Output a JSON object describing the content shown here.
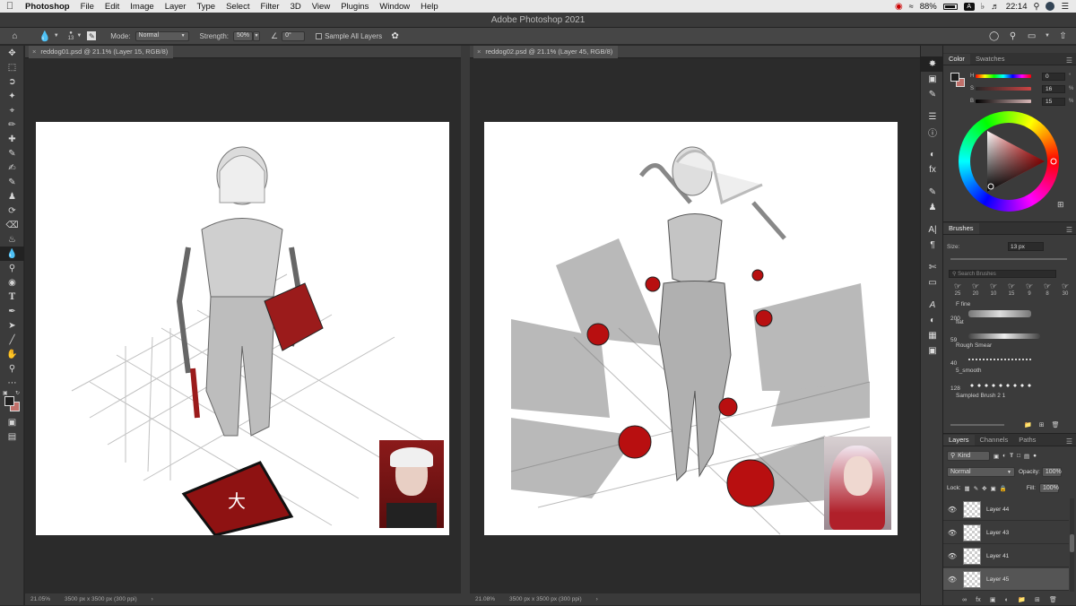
{
  "menubar": {
    "items": [
      "Photoshop",
      "File",
      "Edit",
      "Image",
      "Layer",
      "Type",
      "Select",
      "Filter",
      "3D",
      "View",
      "Plugins",
      "Window",
      "Help"
    ],
    "battery": "88%",
    "input_source": "A",
    "time": "22:14"
  },
  "window_title": "Adobe Photoshop 2021",
  "options": {
    "brush_size": "13",
    "mode_label": "Mode:",
    "mode_value": "Normal",
    "strength_label": "Strength:",
    "strength_value": "50%",
    "angle_value": "0°",
    "sample_all_layers": "Sample All Layers"
  },
  "docs": [
    {
      "tab": "reddog01.psd @ 21.1% (Layer 15, RGB/8)",
      "zoom": "21.05%",
      "info": "3500 px x 3500 px (300 ppi)"
    },
    {
      "tab": "reddog02.psd @ 21.1% (Layer 45, RGB/8)",
      "zoom": "21.08%",
      "info": "3500 px x 3500 px (300 ppi)"
    }
  ],
  "color_panel": {
    "tabs": [
      "Color",
      "Swatches"
    ],
    "h_label": "H",
    "s_label": "S",
    "b_label": "B",
    "h_value": "0",
    "s_value": "16",
    "b_value": "15",
    "h_unit": "°",
    "s_unit": "%",
    "b_unit": "%",
    "foreground_color": "#1e1e1e",
    "background_color": "#c0706a"
  },
  "brushes_panel": {
    "title": "Brushes",
    "size_label": "Size:",
    "size_value": "13 px",
    "search_placeholder": "Search Brushes",
    "tip_sizes": [
      "25",
      "20",
      "10",
      "15",
      "9",
      "8",
      "30"
    ],
    "items": [
      {
        "count": "",
        "name": "F fine"
      },
      {
        "count": "200",
        "name": "flat"
      },
      {
        "count": "59",
        "name": "Rough Smear"
      },
      {
        "count": "40",
        "name": "5_smooth"
      },
      {
        "count": "128",
        "name": "Sampled Brush 2 1"
      }
    ]
  },
  "layers_panel": {
    "tabs": [
      "Layers",
      "Channels",
      "Paths"
    ],
    "kind_label": "Kind",
    "blend_mode": "Normal",
    "opacity_label": "Opacity:",
    "opacity_value": "100%",
    "lock_label": "Lock:",
    "fill_label": "Fill:",
    "fill_value": "100%",
    "layers": [
      {
        "name": "Layer 44"
      },
      {
        "name": "Layer 43"
      },
      {
        "name": "Layer 41"
      },
      {
        "name": "Layer 45"
      }
    ]
  }
}
